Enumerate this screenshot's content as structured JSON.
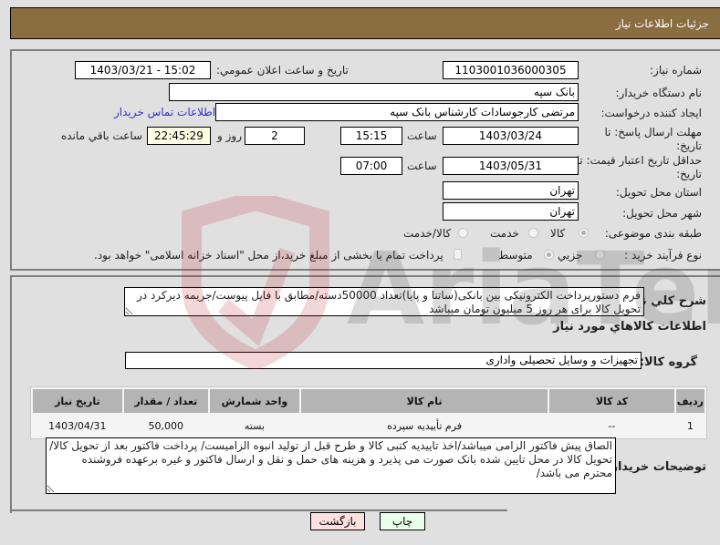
{
  "header": {
    "title": "جزئيات اطلاعات نياز"
  },
  "form": {
    "need_number": {
      "label": "شماره نیاز:",
      "value": "1103001036000305"
    },
    "announce_datetime": {
      "label": "تاريخ و ساعت اعلان عمومي:",
      "value": "1403/03/21 - 15:02"
    },
    "buyer_org": {
      "label": "نام دستگاه خریدار:",
      "value": "بانک سپه"
    },
    "requester": {
      "label": "ایجاد کننده درخواست:",
      "value": "مرتضی کارجوسادات کارشناس بانک سپه"
    },
    "buyer_contact_link": "اطلاعات تماس خریدار",
    "response_deadline": {
      "label": "مهلت ارسال پاسخ: تا تاریخ:",
      "date": "1403/03/24",
      "time_label": "ساعت",
      "time": "15:15",
      "days": "2",
      "days_label": "روز و",
      "remaining": "22:45:29",
      "remaining_label": "ساعت باقي مانده"
    },
    "price_validity": {
      "label": "حداقل تاریخ اعتبار قیمت: تا تاریخ:",
      "date": "1403/05/31",
      "time_label": "ساعت",
      "time": "07:00"
    },
    "delivery_province": {
      "label": "استان محل تحویل:",
      "value": "تهران"
    },
    "delivery_city": {
      "label": "شهر محل تحویل:",
      "value": "تهران"
    },
    "category": {
      "label": "طبقه بندی موضوعی:",
      "options": [
        "کالا",
        "خدمت",
        "کالا/خدمت"
      ],
      "selected": "کالا"
    },
    "purchase_type": {
      "label": "نوع فرآیند خرید :",
      "options": [
        "جزیي",
        "متوسط"
      ],
      "selected": "متوسط",
      "treasury_checkbox_label": "پرداخت تمام یا بخشی از مبلغ خرید،از محل \"اسناد خزانه اسلامی\" خواهد بود.",
      "treasury_checked": false
    }
  },
  "description": {
    "label": "شرح کلي نياز:",
    "value": "فرم دستورپرداخت الکترونیکی بین بانکی(ساتنا و پایا)تعداد 50000دسته/مطابق با فایل پیوست/جریمه دیرکرد در تحویل کالا برای هر روز 5 میلیون تومان میباشد"
  },
  "goods_section": {
    "title": "اطلاعات کالاهاي مورد نياز",
    "group_label": "گروه کالا:",
    "group_value": "تجهیزات و وسایل تحصیلی واداری",
    "table": {
      "headers": [
        "ردیف",
        "کد کالا",
        "نام کالا",
        "واحد شمارش",
        "تعداد / مقدار",
        "تاریخ نیاز"
      ],
      "rows": [
        [
          "1",
          "--",
          "فرم تأییدیه سپرده",
          "بسته",
          "50,000",
          "1403/04/31"
        ]
      ]
    },
    "buyer_notes_label": "توضیحات خریدار:",
    "buyer_notes": "الصاق پیش فاکتور الزامی میباشد/اخذ تاییدیه کتبی کالا و طرح قبل از تولید انبوه الزامیست/ پرداخت فاکتور بعد از تحویل کالا/تحویل کالا در محل تایین شده بانک صورت می پذیرد و هزینه های حمل و نقل و ارسال فاکتور و غیره برعهده فروشنده محترم می باشد/"
  },
  "buttons": {
    "print": "چاپ",
    "back": "بازگشت"
  },
  "colors": {
    "header_bg": "#8b6d42",
    "print_bg": "#eaffea",
    "back_bg": "#ffe0e0",
    "link": "#3333cc"
  }
}
